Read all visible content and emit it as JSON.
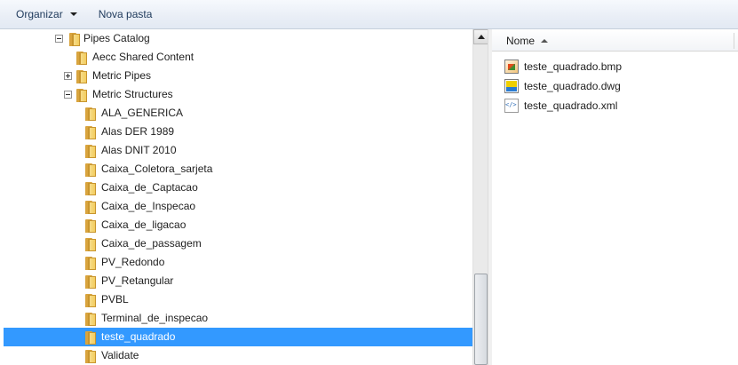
{
  "toolbar": {
    "organize_label": "Organizar",
    "new_folder_label": "Nova pasta"
  },
  "tree": {
    "items": [
      {
        "label": "Pipes Catalog",
        "expander": "minus",
        "selected": false
      },
      {
        "label": "Aecc Shared Content",
        "expander": "none",
        "selected": false
      },
      {
        "label": "Metric Pipes",
        "expander": "plus",
        "selected": false
      },
      {
        "label": "Metric Structures",
        "expander": "minus",
        "selected": false
      },
      {
        "label": "ALA_GENERICA",
        "expander": "none",
        "selected": false
      },
      {
        "label": "Alas DER 1989",
        "expander": "none",
        "selected": false
      },
      {
        "label": "Alas DNIT 2010",
        "expander": "none",
        "selected": false
      },
      {
        "label": "Caixa_Coletora_sarjeta",
        "expander": "none",
        "selected": false
      },
      {
        "label": "Caixa_de_Captacao",
        "expander": "none",
        "selected": false
      },
      {
        "label": "Caixa_de_Inspecao",
        "expander": "none",
        "selected": false
      },
      {
        "label": "Caixa_de_ligacao",
        "expander": "none",
        "selected": false
      },
      {
        "label": "Caixa_de_passagem",
        "expander": "none",
        "selected": false
      },
      {
        "label": "PV_Redondo",
        "expander": "none",
        "selected": false
      },
      {
        "label": "PV_Retangular",
        "expander": "none",
        "selected": false
      },
      {
        "label": "PVBL",
        "expander": "none",
        "selected": false
      },
      {
        "label": "Terminal_de_inspecao",
        "expander": "none",
        "selected": false
      },
      {
        "label": "teste_quadrado",
        "expander": "none",
        "selected": true
      },
      {
        "label": "Validate",
        "expander": "none",
        "selected": false
      }
    ]
  },
  "file_list": {
    "column_name": "Nome",
    "sort": "ascending",
    "files": [
      {
        "name": "teste_quadrado.bmp",
        "icon": "bitmap-file-icon"
      },
      {
        "name": "teste_quadrado.dwg",
        "icon": "dwg-file-icon"
      },
      {
        "name": "teste_quadrado.xml",
        "icon": "xml-file-icon"
      }
    ]
  },
  "colors": {
    "selection": "#3399ff",
    "folder": "#f3cd5e",
    "toolbar_text": "#1e395b"
  }
}
